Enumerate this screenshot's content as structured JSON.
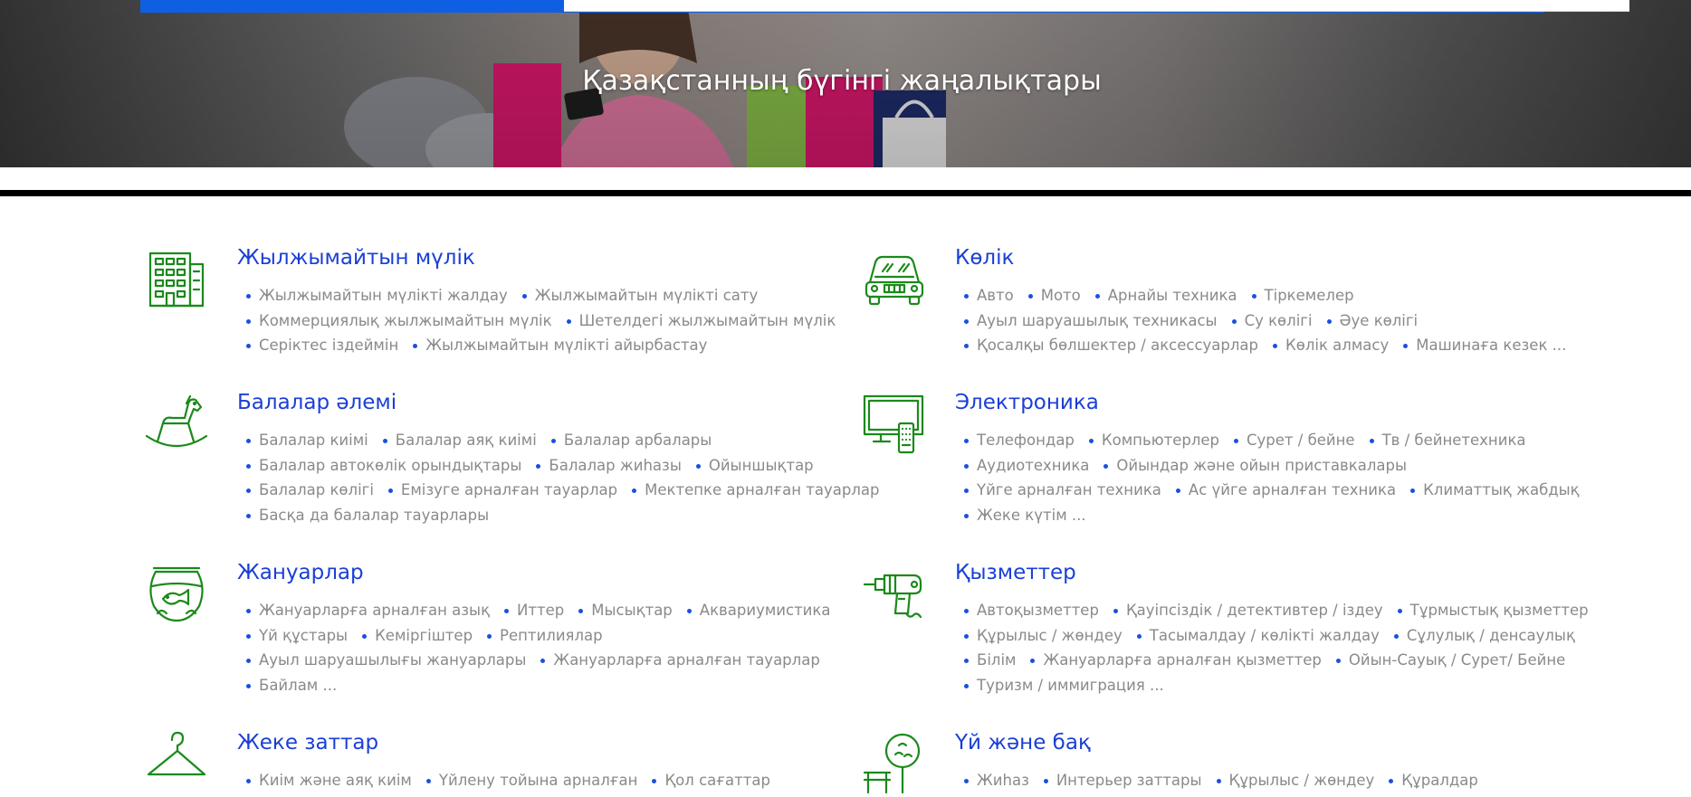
{
  "hero": {
    "title": "Қазақстанның бүгінгі жаңалықтары",
    "search_value": ""
  },
  "colors": {
    "brand_blue": "#0f5fe3",
    "title_blue": "#1a3fd6",
    "icon_green": "#1a8a1a",
    "item_gray": "#8a8a8a"
  },
  "categories": [
    {
      "title": "Жылжымайтын мүлік",
      "icon": "apartment-building-icon",
      "lines": [
        [
          "Жылжымайтын мүлікті жалдау",
          "Жылжымайтын мүлікті сату"
        ],
        [
          "Коммерциялық жылжымайтын мүлік",
          "Шетелдегі жылжымайтын мүлік"
        ],
        [
          "Серіктес іздеймін",
          "Жылжымайтын мүлікті айырбастау"
        ]
      ]
    },
    {
      "title": "Көлік",
      "icon": "car-icon",
      "lines": [
        [
          "Авто",
          "Мото",
          "Арнайы техника",
          "Тіркемелер"
        ],
        [
          "Ауыл шаруашылық техникасы",
          "Су көлігі",
          "Әуе көлігі"
        ],
        [
          "Қосалқы бөлшектер / аксессуарлар",
          "Көлік алмасу",
          "Машинаға кезек ..."
        ]
      ]
    },
    {
      "title": "Балалар әлемі",
      "icon": "rocking-horse-icon",
      "lines": [
        [
          "Балалар киімі",
          "Балалар аяқ киімі",
          "Балалар арбалары"
        ],
        [
          "Балалар автокөлік орындықтары",
          "Балалар жиһазы",
          "Ойыншықтар"
        ],
        [
          "Балалар көлігі",
          "Емізуге арналған тауарлар",
          "Мектепке арналған тауарлар"
        ],
        [
          "Басқа да балалар тауарлары"
        ]
      ]
    },
    {
      "title": "Электроника",
      "icon": "tv-remote-icon",
      "lines": [
        [
          "Телефондар",
          "Компьютерлер",
          "Сурет / бейне",
          "Тв / бейнетехника"
        ],
        [
          "Аудиотехника",
          "Ойындар және ойын приставкалары"
        ],
        [
          "Үйге арналған техника",
          "Ас үйге арналған техника",
          "Климаттық жабдық"
        ],
        [
          "Жеке күтім ..."
        ]
      ]
    },
    {
      "title": "Жануарлар",
      "icon": "aquarium-fish-icon",
      "lines": [
        [
          "Жануарларға арналған азық",
          "Иттер",
          "Мысықтар",
          "Аквариумистика"
        ],
        [
          "Үй құстары",
          "Кеміргіштер",
          "Рептилиялар"
        ],
        [
          "Ауыл шаруашылығы жануарлары",
          "Жануарларға арналған тауарлар"
        ],
        [
          "Байлам ..."
        ]
      ]
    },
    {
      "title": "Қызметтер",
      "icon": "drill-icon",
      "lines": [
        [
          "Автоқызметтер",
          "Қауіпсіздік / детективтер / іздеу",
          "Тұрмыстық қызметтер"
        ],
        [
          "Құрылыс / жөндеу",
          "Тасымалдау / көлікті жалдау",
          "Сұлулық / денсаулық"
        ],
        [
          "Білім",
          "Жануарларға арналған қызметтер",
          "Ойын-Сауық / Сурет/ Бейне"
        ],
        [
          "Туризм / иммиграция ..."
        ]
      ]
    },
    {
      "title": "Жеке заттар",
      "icon": "clothes-hanger-icon",
      "lines": [
        [
          "Киім және аяқ киім",
          "Үйлену тойына арналған",
          "Қол сағаттар"
        ]
      ]
    },
    {
      "title": "Үй және бақ",
      "icon": "tree-bench-icon",
      "lines": [
        [
          "Жиһаз",
          "Интерьер заттары",
          "Құрылыс / жөндеу",
          "Құралдар"
        ]
      ]
    }
  ]
}
